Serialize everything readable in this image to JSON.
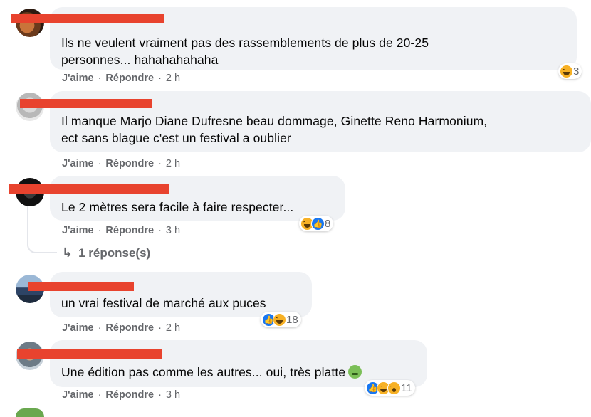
{
  "comments": [
    {
      "text_lines": [
        "Ils ne veulent vraiment pas des rassemblements de plus de 20-25",
        "personnes... hahahahahaha"
      ],
      "like_label": "J'aime",
      "reply_label": "Répondre",
      "time": "2 h",
      "reaction_icons": [
        "haha-icon"
      ],
      "reaction_count": "3"
    },
    {
      "text_lines": [
        "Il manque Marjo Diane Dufresne beau dommage, Ginette Reno Harmonium,",
        "ect sans blague c'est un festival a oublier"
      ],
      "like_label": "J'aime",
      "reply_label": "Répondre",
      "time": "2 h"
    },
    {
      "text_lines": [
        "Le 2 mètres sera facile à faire respecter..."
      ],
      "like_label": "J'aime",
      "reply_label": "Répondre",
      "time": "3 h",
      "reaction_icons": [
        "haha-icon",
        "like-icon"
      ],
      "reaction_count": "8",
      "replies_label": "1 réponse(s)"
    },
    {
      "text_lines": [
        "un vrai festival de marché aux puces"
      ],
      "like_label": "J'aime",
      "reply_label": "Répondre",
      "time": "2 h",
      "reaction_icons": [
        "like-icon",
        "haha-icon"
      ],
      "reaction_count": "18"
    },
    {
      "text_lines": [
        "Une édition pas comme les autres... oui, très platte"
      ],
      "trailing_emoji": "nauseated-face-icon",
      "like_label": "J'aime",
      "reply_label": "Répondre",
      "time": "3 h",
      "reaction_icons": [
        "like-icon",
        "haha-icon",
        "wow-icon"
      ],
      "reaction_count": "11"
    }
  ],
  "colors": {
    "bubble": "#f0f2f5",
    "redaction": "#e8432e",
    "meta_text": "#65676b",
    "like_blue": "#1877f2",
    "haha_yellow": "#f7b125"
  }
}
